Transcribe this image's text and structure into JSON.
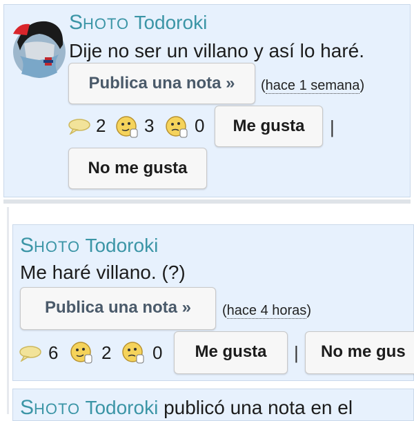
{
  "posts": [
    {
      "author_first": "S",
      "author_rest": "HOTO",
      "author_last": "Todoroki",
      "message": "Dije no ser un villano y así lo haré.",
      "note_button": "Publica una nota »",
      "time_open": "(",
      "time_link": "hace 1 semana",
      "time_close": ")",
      "comments": "2",
      "likes": "3",
      "dislikes": "0",
      "like_button": "Me gusta",
      "separator": "|",
      "dislike_button": "No me gusta"
    },
    {
      "author_first": "S",
      "author_rest": "HOTO",
      "author_last": "Todoroki",
      "message": "Me haré villano. (?)",
      "note_button": "Publica una nota »",
      "time_open": "(",
      "time_link": "hace 4 horas",
      "time_close": ")",
      "comments": "6",
      "likes": "2",
      "dislikes": "0",
      "like_button": "Me gusta",
      "separator": "|",
      "dislike_button": "No me gus"
    }
  ],
  "next_post": {
    "author_first": "S",
    "author_rest": "HOTO",
    "author_last": "Todoroki",
    "text": " publicó una nota en el"
  },
  "colors": {
    "card_bg": "#e7f1fd",
    "name": "#3b95a6",
    "comment_bubble": "#f2e39a",
    "emoji": "#f5d35b"
  },
  "icons": [
    "avatar",
    "speech-bubble-icon",
    "thumbs-up-emoji-icon",
    "thumbs-down-emoji-icon"
  ]
}
